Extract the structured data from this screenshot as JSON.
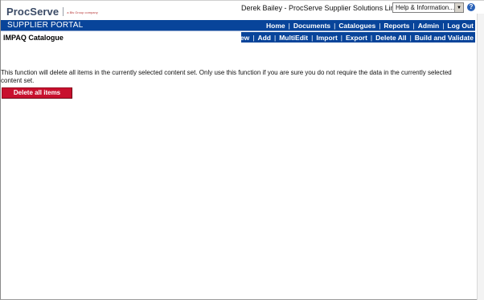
{
  "header": {
    "logo_text": "ProcServe",
    "logo_subtext": "a Bls Group company",
    "user_info": "Derek Bailey - ProcServe Supplier Solutions Limited",
    "help_select": {
      "selected": "Help & Information..."
    },
    "help_icon": "?"
  },
  "portal": {
    "title": "SUPPLIER PORTAL",
    "nav": [
      {
        "label": "Home"
      },
      {
        "label": "Documents"
      },
      {
        "label": "Catalogues"
      },
      {
        "label": "Reports"
      },
      {
        "label": "Admin"
      },
      {
        "label": "Log Out"
      }
    ]
  },
  "page": {
    "title": "IMPAQ Catalogue",
    "actions": [
      {
        "label": "View"
      },
      {
        "label": "Add"
      },
      {
        "label": "MultiEdit"
      },
      {
        "label": "Import"
      },
      {
        "label": "Export"
      },
      {
        "label": "Delete All"
      },
      {
        "label": "Build and Validate"
      }
    ]
  },
  "content": {
    "warning": "This function will delete all items in the currently selected content set.  Only use this function if you are sure you do not require the data in the currently selected content set.",
    "delete_button_label": "Delete all items"
  },
  "colors": {
    "nav_bar": "#08449a",
    "delete_button": "#c8102e",
    "logo": "#3a4a66"
  },
  "icons": {
    "help": "help-icon",
    "dropdown": "chevron-down-icon"
  }
}
